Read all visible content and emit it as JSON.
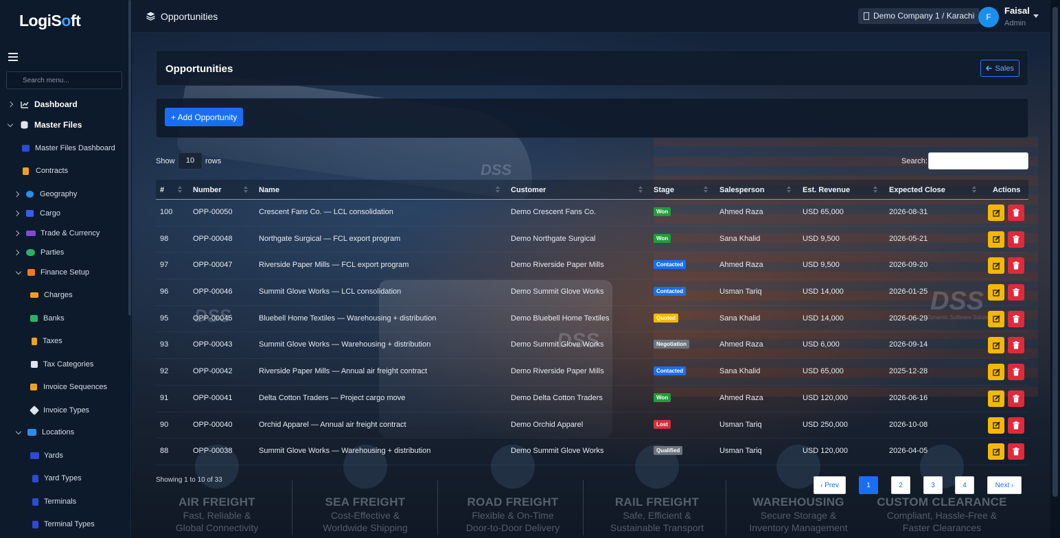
{
  "app": {
    "logo_prefix": "LogiS",
    "logo_o": "o",
    "logo_suffix": "ft"
  },
  "sidebar": {
    "search_placeholder": "Search menu...",
    "items": [
      {
        "label": "Dashboard",
        "icon": "chart-line-icon"
      },
      {
        "label": "Master Files",
        "icon": "database-icon"
      },
      {
        "label": "Master Files Dashboard",
        "icon": "dashboard-icon"
      },
      {
        "label": "Contracts",
        "icon": "file-icon"
      },
      {
        "label": "Geography",
        "icon": "globe-icon"
      },
      {
        "label": "Cargo",
        "icon": "box-icon"
      },
      {
        "label": "Trade & Currency",
        "icon": "handshake-icon"
      },
      {
        "label": "Parties",
        "icon": "users-icon"
      },
      {
        "label": "Finance Setup",
        "icon": "coins-icon"
      },
      {
        "label": "Charges",
        "icon": "money-bill-icon"
      },
      {
        "label": "Banks",
        "icon": "bank-icon"
      },
      {
        "label": "Taxes",
        "icon": "receipt-icon"
      },
      {
        "label": "Tax Categories",
        "icon": "layers-icon"
      },
      {
        "label": "Invoice Sequences",
        "icon": "list-ordered-icon"
      },
      {
        "label": "Invoice Types",
        "icon": "tag-icon"
      },
      {
        "label": "Locations",
        "icon": "warehouse-icon"
      },
      {
        "label": "Yards",
        "icon": "yard-icon"
      },
      {
        "label": "Yard Types",
        "icon": "yard-type-icon"
      },
      {
        "label": "Terminals",
        "icon": "terminal-icon"
      },
      {
        "label": "Terminal Types",
        "icon": "terminal-type-icon"
      }
    ]
  },
  "header": {
    "title": "Opportunities",
    "company": "Demo Company 1 / Karachi",
    "user_initial": "F",
    "user_name": "Faisal",
    "user_role": "Admin"
  },
  "card": {
    "title": "Opportunities",
    "back_label": "Sales",
    "add_label": "+ Add Opportunity"
  },
  "table_controls": {
    "show_label": "Show",
    "rows_value": "10",
    "rows_label": "rows",
    "search_label": "Search:"
  },
  "table": {
    "columns": [
      "#",
      "Number",
      "Name",
      "Customer",
      "Stage",
      "Salesperson",
      "Est. Revenue",
      "Expected Close",
      "Actions"
    ],
    "rows": [
      {
        "id": "100",
        "number": "OPP-00050",
        "name": "Crescent Fans Co. — LCL consolidation",
        "customer": "Demo Crescent Fans Co.",
        "stage": "Won",
        "salesperson": "Ahmed Raza",
        "revenue": "USD 65,000",
        "close": "2026-08-31"
      },
      {
        "id": "98",
        "number": "OPP-00048",
        "name": "Northgate Surgical — FCL export program",
        "customer": "Demo Northgate Surgical",
        "stage": "Won",
        "salesperson": "Sana Khalid",
        "revenue": "USD 9,500",
        "close": "2026-05-21"
      },
      {
        "id": "97",
        "number": "OPP-00047",
        "name": "Riverside Paper Mills — FCL export program",
        "customer": "Demo Riverside Paper Mills",
        "stage": "Contacted",
        "salesperson": "Ahmed Raza",
        "revenue": "USD 9,500",
        "close": "2026-09-20"
      },
      {
        "id": "96",
        "number": "OPP-00046",
        "name": "Summit Glove Works — LCL consolidation",
        "customer": "Demo Summit Glove Works",
        "stage": "Contacted",
        "salesperson": "Usman Tariq",
        "revenue": "USD 14,000",
        "close": "2026-01-25"
      },
      {
        "id": "95",
        "number": "OPP-00045",
        "name": "Bluebell Home Textiles — Warehousing + distribution",
        "customer": "Demo Bluebell Home Textiles",
        "stage": "Quoted",
        "salesperson": "Sana Khalid",
        "revenue": "USD 14,000",
        "close": "2026-06-29"
      },
      {
        "id": "93",
        "number": "OPP-00043",
        "name": "Summit Glove Works — Warehousing + distribution",
        "customer": "Demo Summit Glove Works",
        "stage": "Negotiation",
        "salesperson": "Ahmed Raza",
        "revenue": "USD 6,000",
        "close": "2026-09-14"
      },
      {
        "id": "92",
        "number": "OPP-00042",
        "name": "Riverside Paper Mills — Annual air freight contract",
        "customer": "Demo Riverside Paper Mills",
        "stage": "Contacted",
        "salesperson": "Sana Khalid",
        "revenue": "USD 65,000",
        "close": "2025-12-28"
      },
      {
        "id": "91",
        "number": "OPP-00041",
        "name": "Delta Cotton Traders — Project cargo move",
        "customer": "Demo Delta Cotton Traders",
        "stage": "Won",
        "salesperson": "Ahmed Raza",
        "revenue": "USD 120,000",
        "close": "2026-06-16"
      },
      {
        "id": "90",
        "number": "OPP-00040",
        "name": "Orchid Apparel — Annual air freight contract",
        "customer": "Demo Orchid Apparel",
        "stage": "Lost",
        "salesperson": "Usman Tariq",
        "revenue": "USD 250,000",
        "close": "2026-10-08"
      },
      {
        "id": "88",
        "number": "OPP-00038",
        "name": "Summit Glove Works — Warehousing + distribution",
        "customer": "Demo Summit Glove Works",
        "stage": "Qualified",
        "salesperson": "Usman Tariq",
        "revenue": "USD 120,000",
        "close": "2026-04-05"
      }
    ],
    "stage_colors": {
      "Won": "#1f9d3a",
      "Contacted": "#1a6ef5",
      "Quoted": "#f5b800",
      "Negotiation": "#6c757d",
      "Lost": "#d32f3f",
      "Qualified": "#6c757d"
    }
  },
  "pagination": {
    "summary": "Showing 1 to 10 of 33",
    "prev_label": "‹ Prev",
    "next_label": "Next ›",
    "pages": [
      "1",
      "2",
      "3",
      "4"
    ],
    "current": "1"
  },
  "background": {
    "brand_watermark": "DSS",
    "brand_tagline": "Dynamic Software Solutions",
    "services": [
      {
        "title": "AIR FREIGHT",
        "line1": "Fast, Reliable &",
        "line2": "Global Connectivity"
      },
      {
        "title": "SEA FREIGHT",
        "line1": "Cost-Effective &",
        "line2": "Worldwide Shipping"
      },
      {
        "title": "ROAD FREIGHT",
        "line1": "Flexible & On-Time",
        "line2": "Door-to-Door Delivery"
      },
      {
        "title": "RAIL FREIGHT",
        "line1": "Safe, Efficient &",
        "line2": "Sustainable Transport"
      },
      {
        "title": "WAREHOUSING",
        "line1": "Secure Storage &",
        "line2": "Inventory Management"
      },
      {
        "title": "CUSTOM CLEARANCE",
        "line1": "Compliant, Hassle-Free &",
        "line2": "Faster Clearances"
      }
    ]
  }
}
